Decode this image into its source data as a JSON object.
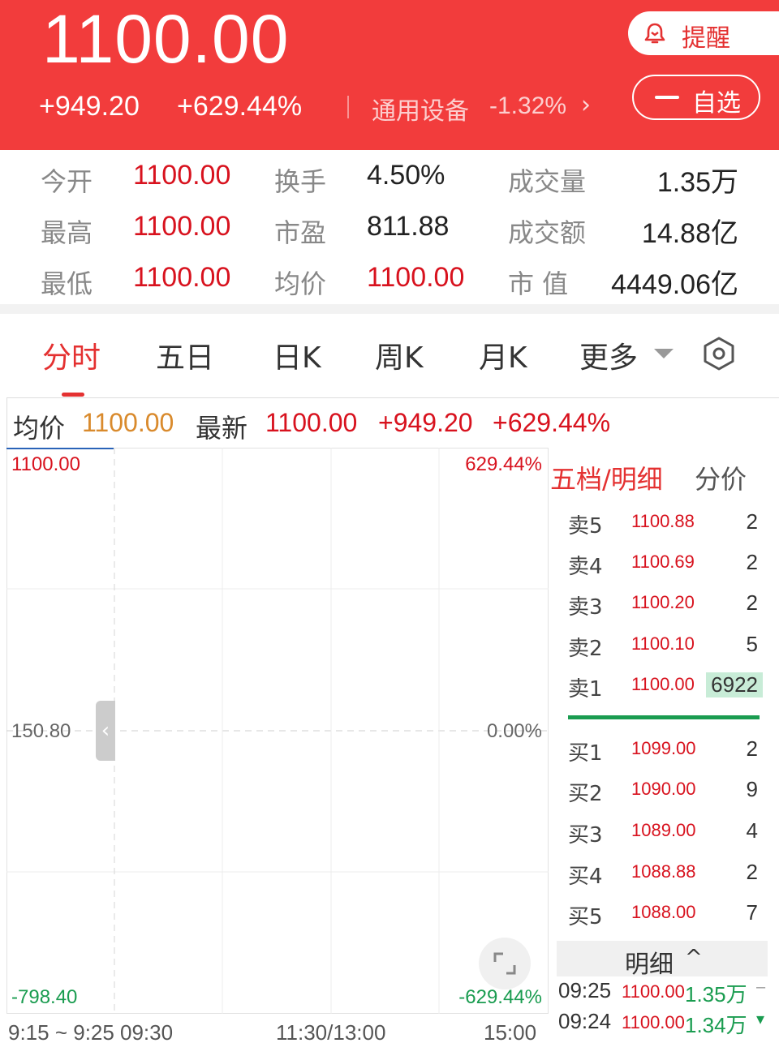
{
  "header": {
    "price": "1100.00",
    "change_abs": "+949.20",
    "change_pct": "+629.44%",
    "sector_name": "通用设备",
    "sector_pct": "-1.32%",
    "sector_arrow": "›",
    "remind_label": "提醒",
    "watchlist_label": "自选"
  },
  "stats": {
    "open_label": "今开",
    "open": "1100.00",
    "turnover_label": "换手",
    "turnover": "4.50%",
    "volume_label": "成交量",
    "volume": "1.35万",
    "high_label": "最高",
    "high": "1100.00",
    "pe_label": "市盈",
    "pe": "811.88",
    "amount_label": "成交额",
    "amount": "14.88亿",
    "low_label": "最低",
    "low": "1100.00",
    "avg_label": "均价",
    "avg": "1100.00",
    "mcap_label": "市 值",
    "mcap": "4449.06亿"
  },
  "tabs": [
    "分时",
    "五日",
    "日K",
    "周K",
    "月K",
    "更多"
  ],
  "infobar": {
    "avg_label": "均价",
    "avg": "1100.00",
    "last_label": "最新",
    "last": "1100.00",
    "chg": "+949.20",
    "pct": "+629.44%"
  },
  "chart": {
    "y_top": "1100.00",
    "y_mid": "150.80",
    "y_bot": "-798.40",
    "pct_top": "629.44%",
    "pct_mid": "0.00%",
    "pct_bot": "-629.44%",
    "x_labels": [
      "9:15 ~ 9:25",
      "09:30",
      "11:30/13:00",
      "15:00"
    ],
    "collapse_glyph": "‹"
  },
  "orderbook": {
    "tab_active": "五档/明细",
    "tab_other": "分价",
    "asks": [
      {
        "label": "卖5",
        "price": "1100.88",
        "vol": "2"
      },
      {
        "label": "卖4",
        "price": "1100.69",
        "vol": "2"
      },
      {
        "label": "卖3",
        "price": "1100.20",
        "vol": "2"
      },
      {
        "label": "卖2",
        "price": "1100.10",
        "vol": "5"
      },
      {
        "label": "卖1",
        "price": "1100.00",
        "vol": "6922"
      }
    ],
    "bids": [
      {
        "label": "买1",
        "price": "1099.00",
        "vol": "2"
      },
      {
        "label": "买2",
        "price": "1090.00",
        "vol": "9"
      },
      {
        "label": "买3",
        "price": "1089.00",
        "vol": "4"
      },
      {
        "label": "买4",
        "price": "1088.88",
        "vol": "2"
      },
      {
        "label": "买5",
        "price": "1088.00",
        "vol": "7"
      }
    ],
    "detail_label": "明细",
    "detail_caret": "^",
    "trades": [
      {
        "time": "09:25",
        "price": "1100.00",
        "vol": "1.35万",
        "mark": "–"
      },
      {
        "time": "09:24",
        "price": "1100.00",
        "vol": "1.34万",
        "mark": "▾"
      }
    ]
  },
  "colors": {
    "brand_red": "#f23c3c",
    "up_red": "#d8121e",
    "down_green": "#1a9c50",
    "avg_orange": "#d98a2c"
  }
}
